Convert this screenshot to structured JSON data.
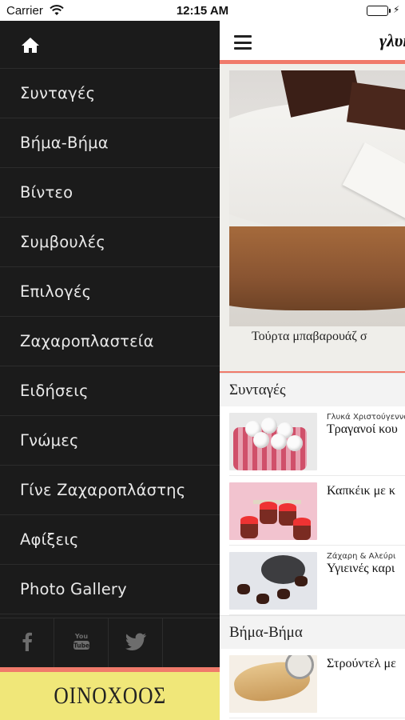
{
  "status_bar": {
    "carrier": "Carrier",
    "time": "12:15 AM"
  },
  "side_menu": {
    "items": [
      {
        "label": "Συνταγές"
      },
      {
        "label": "Βήμα-Βήμα"
      },
      {
        "label": "Βίντεο"
      },
      {
        "label": "Συμβουλές"
      },
      {
        "label": "Επιλογές"
      },
      {
        "label": "Ζαχαροπλαστεία"
      },
      {
        "label": "Ειδήσεις"
      },
      {
        "label": "Γνώμες"
      },
      {
        "label": "Γίνε Ζαχαροπλάστης"
      },
      {
        "label": "Αφίξεις"
      },
      {
        "label": "Photo Gallery"
      }
    ],
    "social": [
      "facebook-icon",
      "youtube-icon",
      "twitter-icon"
    ],
    "ad_text": "ΟΙΝΟΧΟΟΣ"
  },
  "main": {
    "logo": "γλυκ",
    "hero_caption": "Τούρτα μπαβαρουάζ σ",
    "sections": [
      {
        "title": "Συνταγές",
        "items": [
          {
            "category": "Γλυκά Χριστούγεννα",
            "title": "Τραγανοί κου"
          },
          {
            "category": "",
            "title": "Καπκέικ με κ"
          },
          {
            "category": "Ζάχαρη & Αλεύρι",
            "title": "Υγιεινές καρι"
          }
        ]
      },
      {
        "title": "Βήμα-Βήμα",
        "items": [
          {
            "category": "",
            "title": "Στρούντελ με"
          }
        ]
      }
    ]
  },
  "colors": {
    "menu_bg": "#1b1b1b",
    "accent": "#f07a6b",
    "ad_bg": "#f0e779",
    "battery": "#3bc33b"
  }
}
